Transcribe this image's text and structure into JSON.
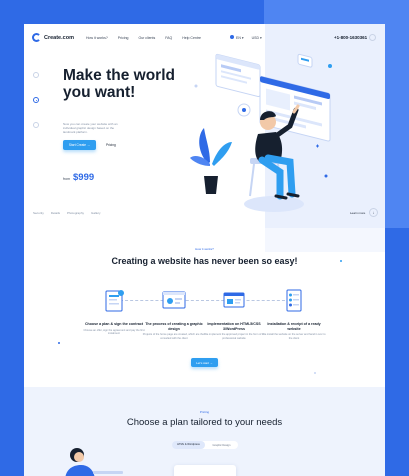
{
  "colors": {
    "frame": "#2f6ae6",
    "accent": "#2f9ef0",
    "brand": "#2f6ae6",
    "text": "#16202f"
  },
  "header": {
    "logo_text": "Create.com",
    "nav": [
      "How it works?",
      "Pricing",
      "Our clients",
      "FAQ",
      "Help Centre"
    ],
    "lang": [
      "EN",
      "USD"
    ],
    "phone": "+1-800-1630361"
  },
  "hero": {
    "title": "Make the world you want!",
    "description": "Now you can create your website with an individual graphic design based on the landmark platform.",
    "primary_button": "Start Create",
    "secondary_link": "Pricing",
    "price_from": "from",
    "price": "$999",
    "bottom_links": [
      "Security",
      "Details",
      "Photography",
      "Gallery"
    ],
    "learn_more": "Learn more",
    "learn_more_icon": "arrow-down-icon"
  },
  "section2": {
    "tag": "How it works?",
    "title": "Creating a website has never been so easy!",
    "steps": [
      {
        "title": "Choose a plan & sign the contract",
        "desc": "Choose an offer, sign the agreement and pay the first instalment"
      },
      {
        "title": "The process of creating a graphic design",
        "desc": "Projects of the home page are created, which are then consulted with the client"
      },
      {
        "title": "Implementation on HTML5/CSS 3/WordPress",
        "desc": "We implement the approved project in the form of a professional website"
      },
      {
        "title": "Installation & receipt of a ready website",
        "desc": "We install the website on the server and hand it over to the client"
      }
    ],
    "button": "Let's start"
  },
  "section3": {
    "tag": "Pricing",
    "title": "Choose a plan tailored to your needs",
    "toggle": [
      "HTML & Wordpress",
      "Graphic Design"
    ]
  }
}
